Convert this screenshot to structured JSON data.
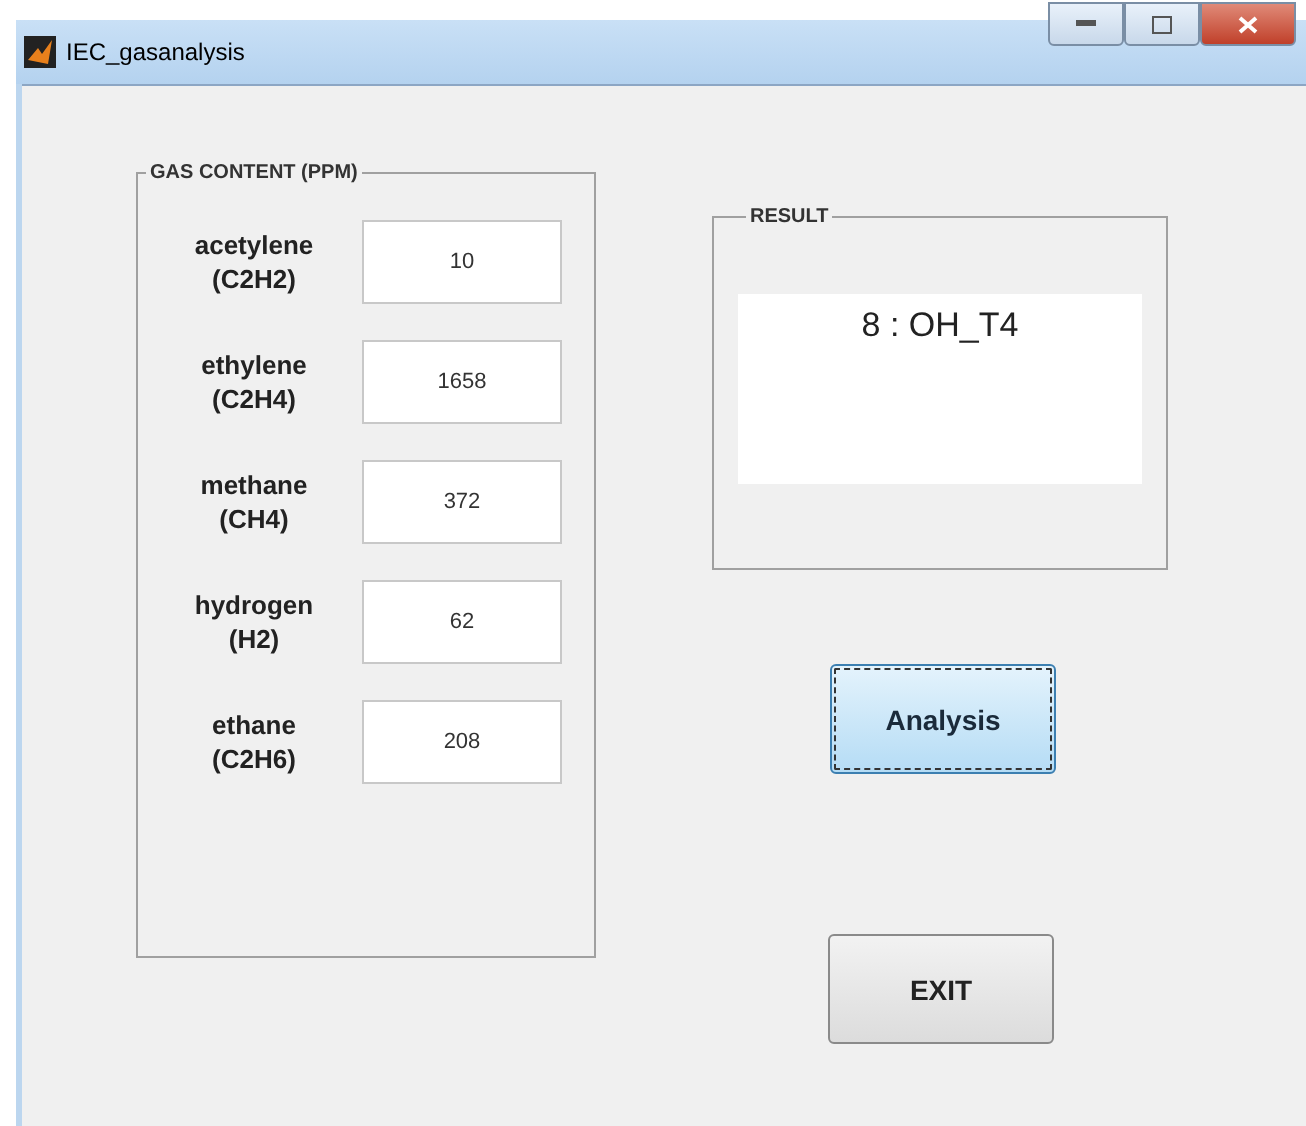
{
  "window": {
    "title": "IEC_gasanalysis"
  },
  "gas_content": {
    "title": "GAS CONTENT (PPM)",
    "rows": [
      {
        "name": "acetylene",
        "formula": "(C2H2)",
        "value": "10"
      },
      {
        "name": "ethylene",
        "formula": "(C2H4)",
        "value": "1658"
      },
      {
        "name": "methane",
        "formula": "(CH4)",
        "value": "372"
      },
      {
        "name": "hydrogen",
        "formula": "(H2)",
        "value": "62"
      },
      {
        "name": "ethane",
        "formula": "(C2H6)",
        "value": "208"
      }
    ]
  },
  "result": {
    "title": "RESULT",
    "text": "8 : OH_T4"
  },
  "buttons": [
    {
      "label": "Analysis",
      "focused": true
    },
    {
      "label": "EXIT",
      "focused": false
    }
  ]
}
